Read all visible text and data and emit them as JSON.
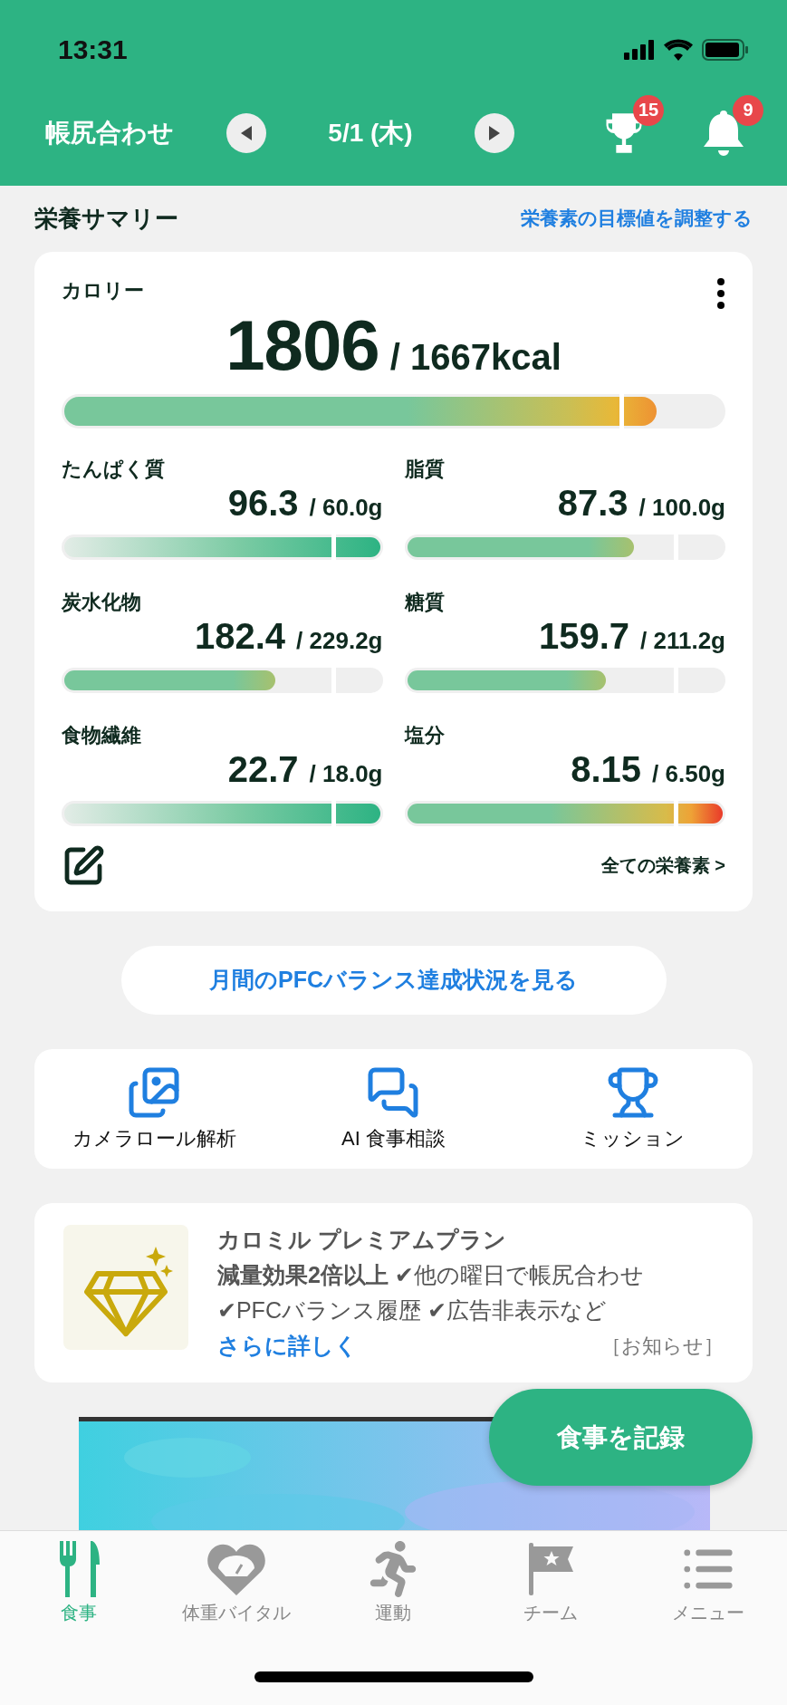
{
  "status_bar": {
    "time": "13:31"
  },
  "header": {
    "title": "帳尻合わせ",
    "date": "5/1 (木)",
    "trophy_badge": "15",
    "bell_badge": "9"
  },
  "summary": {
    "title": "栄養サマリー",
    "adjust_link": "栄養素の目標値を調整する"
  },
  "calorie": {
    "label": "カロリー",
    "value": "1806",
    "target": "/ 1667kcal",
    "level": 0.9,
    "kind": "over_warn"
  },
  "nutrients": [
    {
      "label": "たんぱく質",
      "value": "96.3",
      "target": "/ 60.0g",
      "level": 1,
      "kind": "over_good"
    },
    {
      "label": "脂質",
      "value": "87.3",
      "target": "/ 100.0g",
      "level": 0.72,
      "kind": "under"
    },
    {
      "label": "炭水化物",
      "value": "182.4",
      "target": "/ 229.2g",
      "level": 0.67,
      "kind": "under"
    },
    {
      "label": "糖質",
      "value": "159.7",
      "target": "/ 211.2g",
      "level": 0.63,
      "kind": "under"
    },
    {
      "label": "食物繊維",
      "value": "22.7",
      "target": "/ 18.0g",
      "level": 1,
      "kind": "over_good"
    },
    {
      "label": "塩分",
      "value": "8.15",
      "target": "/ 6.50g",
      "level": 1,
      "kind": "over_bad"
    }
  ],
  "all_nutrients_link": "全ての栄養素 >",
  "pfc_button": "月間のPFCバランス達成状況を見る",
  "shortcuts": [
    {
      "kind": "photos",
      "label": "カメラロール解析"
    },
    {
      "kind": "chat",
      "label": "AI 食事相談"
    },
    {
      "kind": "trophy",
      "label": "ミッション"
    }
  ],
  "premium": {
    "title": "カロミル プレミアムプラン",
    "line_1": "**減量効果2倍以上** ✔他の曜日で帳尻合わせ",
    "line_2": "✔PFCバランス履歴 ✔広告非表示など",
    "link": "さらに詳しく",
    "notice": "［お知らせ］"
  },
  "fab": "食事を記録",
  "tabs": [
    {
      "kind": "meal",
      "label": "食事",
      "selected": true
    },
    {
      "kind": "weight",
      "label": "体重バイタル",
      "selected": false
    },
    {
      "kind": "run",
      "label": "運動",
      "selected": false
    },
    {
      "kind": "team",
      "label": "チーム",
      "selected": false
    },
    {
      "kind": "menu",
      "label": "メニュー",
      "selected": false
    }
  ]
}
